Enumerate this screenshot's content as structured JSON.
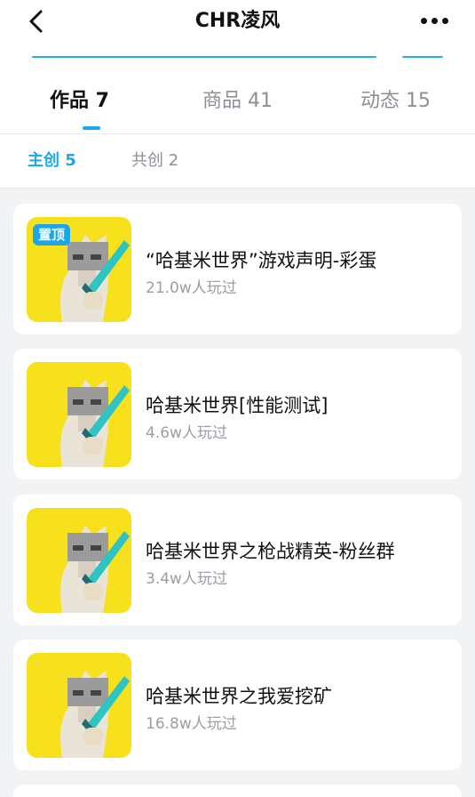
{
  "header": {
    "title": "CHR凌风",
    "back_icon": "chevron-left-icon",
    "more_icon": "more-dots-icon"
  },
  "tabs": [
    {
      "label": "作品 7",
      "active": true
    },
    {
      "label": "商品 41",
      "active": false
    },
    {
      "label": "动态 15",
      "active": false
    }
  ],
  "subtabs": [
    {
      "label": "主创 5",
      "active": true
    },
    {
      "label": "共创 2",
      "active": false
    }
  ],
  "colors": {
    "accent": "#17a9ef",
    "thumb_bg": "#f7e11c",
    "badge_bg": "#1aa6e8"
  },
  "works": [
    {
      "title": "“哈基米世界”游戏声明-彩蛋",
      "plays": "21.0w人玩过",
      "badge": "置顶"
    },
    {
      "title": "哈基米世界[性能测试]",
      "plays": "4.6w人玩过"
    },
    {
      "title": "哈基米世界之枪战精英-粉丝群",
      "plays": "3.4w人玩过"
    },
    {
      "title": "哈基米世界之我爱挖矿",
      "plays": "16.8w人玩过"
    }
  ]
}
